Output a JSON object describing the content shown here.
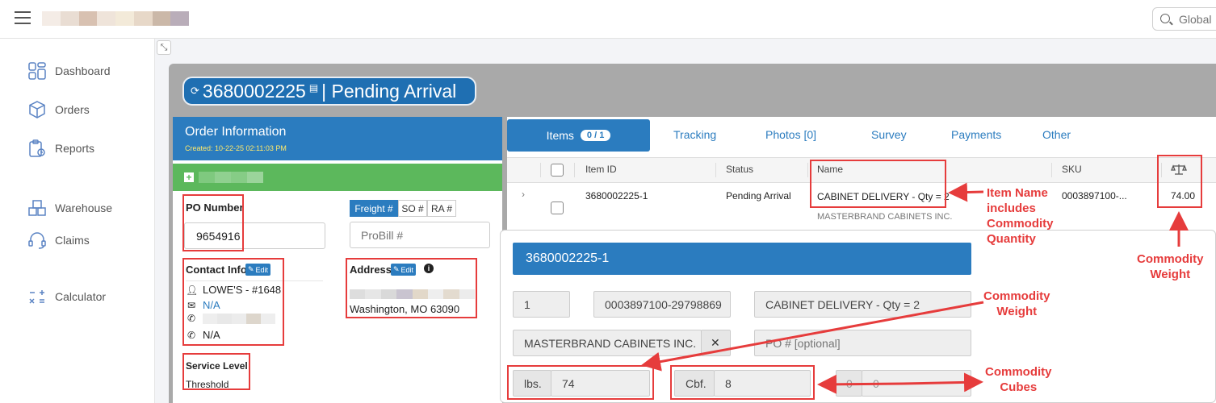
{
  "header": {
    "search_placeholder": "Global",
    "logo_blur_colors": [
      "#f4ece6",
      "#e9ddd3",
      "#d8c1b1",
      "#efe4da",
      "#f3ead9",
      "#e7d8c8",
      "#cbb8a8",
      "#b9adb9"
    ]
  },
  "sidebar": {
    "items": [
      {
        "label": "Dashboard",
        "icon": "dashboard-icon"
      },
      {
        "label": "Orders",
        "icon": "box-icon"
      },
      {
        "label": "Reports",
        "icon": "report-icon"
      },
      {
        "label": "Warehouse",
        "icon": "warehouse-icon"
      },
      {
        "label": "Claims",
        "icon": "headset-icon"
      },
      {
        "label": "Calculator",
        "icon": "calculator-icon"
      }
    ]
  },
  "order": {
    "number": "3680002225",
    "status_text": "| Pending Arrival"
  },
  "order_info": {
    "title": "Order Information",
    "created": "Created: 10-22-25 02:11:03 PM",
    "po_label": "PO Number",
    "po_value": "9654916",
    "ref_tabs": [
      "Freight #",
      "SO #",
      "RA #"
    ],
    "probill_placeholder": "ProBill #",
    "contact_label": "Contact Info",
    "edit_label": "Edit",
    "contact_name": "LOWE'S - #1648",
    "contact_email": "N/A",
    "contact_phone2": "N/A",
    "address_label": "Address",
    "address_line2": "Washington, MO 63090",
    "service_label": "Service Level",
    "service_value": "Threshold"
  },
  "tabs": {
    "items_label": "Items",
    "items_badge": "0 / 1",
    "others": [
      "Tracking",
      "Photos [0]",
      "Survey",
      "Payments",
      "Other"
    ]
  },
  "items_table": {
    "columns": [
      "Item ID",
      "Status",
      "Name",
      "SKU"
    ],
    "weight_icon": "balance-scale-icon",
    "row": {
      "item_id": "3680002225-1",
      "status": "Pending Arrival",
      "name": "CABINET DELIVERY - Qty = 2",
      "vendor": "MASTERBRAND CABINETS INC.",
      "sku": "0003897100-...",
      "weight": "74.00"
    }
  },
  "item_detail": {
    "title": "3680002225-1",
    "qty": "1",
    "sku": "0003897100-29798869",
    "name": "CABINET DELIVERY - Qty = 2",
    "vendor": "MASTERBRAND CABINETS INC.",
    "po_placeholder": "PO # [optional]",
    "lbs_label": "lbs.",
    "lbs_value": "74",
    "cbf_label": "Cbf.",
    "cbf_value": "8",
    "extra_a": "0",
    "extra_b": "0"
  },
  "annotations": {
    "item_name_note": [
      "Item Name",
      "includes",
      "Commodity",
      "Quantity"
    ],
    "weight_note_top": [
      "Commodity",
      "Weight"
    ],
    "weight_note_mid": [
      "Commodity",
      "Weight"
    ],
    "cubes_note": [
      "Commodity",
      "Cubes"
    ]
  },
  "colors": {
    "primary": "#2b7cbf",
    "green": "#5cb85c",
    "annotation_red": "#e63c3c",
    "created_yellow": "#ffe96b"
  }
}
